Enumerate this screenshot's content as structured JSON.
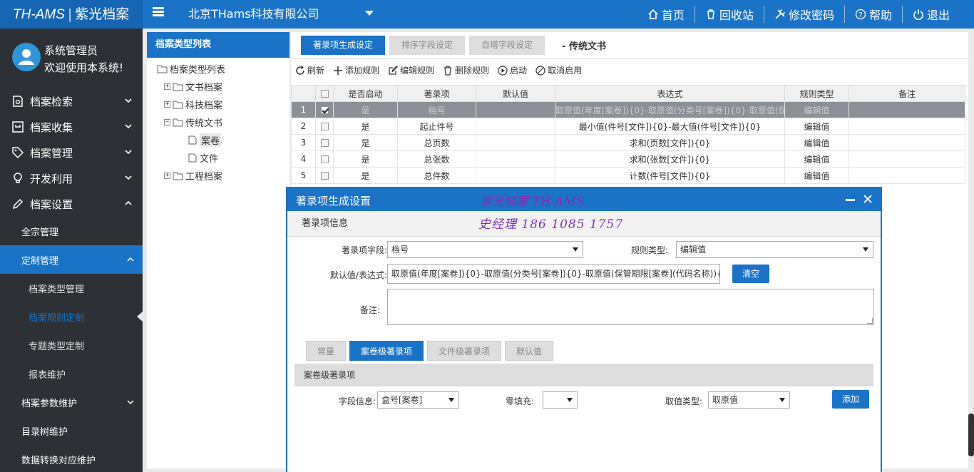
{
  "app": {
    "brand": "TH-AMS",
    "brand_cn": "紫光档案",
    "company": "北京THams科技有限公司"
  },
  "topnav": {
    "home": "首页",
    "recycle": "回收站",
    "password": "修改密码",
    "help": "帮助",
    "logout": "退出"
  },
  "user": {
    "name": "系统管理员",
    "welcome": "欢迎使用本系统!"
  },
  "sidebar": {
    "items": [
      {
        "label": "档案检索",
        "icon": "search-doc-icon"
      },
      {
        "label": "档案收集",
        "icon": "inbox-icon"
      },
      {
        "label": "档案管理",
        "icon": "tag-icon"
      },
      {
        "label": "开发利用",
        "icon": "lightbulb-icon"
      },
      {
        "label": "档案设置",
        "icon": "pencil-icon"
      }
    ],
    "settings_sub": {
      "quanzong": "全宗管理",
      "custom": "定制管理",
      "custom_children": [
        "档案类型管理",
        "档案规则定制",
        "专题类型定制",
        "报表维护"
      ],
      "params": "档案参数维护",
      "catalog_tree": "目录树维护",
      "data_convert": "数据转换对应维护"
    }
  },
  "tree": {
    "header": "档案类型列表",
    "root": "档案类型列表",
    "nodes": [
      "文书档案",
      "科技档案",
      "传统文书",
      "案卷",
      "文件",
      "工程档案"
    ]
  },
  "main": {
    "tabs": [
      "著录项生成设定",
      "排序字段设定",
      "自增字段设定"
    ],
    "title": "- 传统文书",
    "toolbar": {
      "refresh": "刷新",
      "add": "添加规则",
      "edit": "编辑规则",
      "delete": "删除规则",
      "start": "启动",
      "cancel": "取消启用"
    },
    "columns": [
      "是否启动",
      "著录项",
      "默认值",
      "表达式",
      "规则类型",
      "备注"
    ],
    "rows": [
      {
        "no": "1",
        "checked": true,
        "enabled": "是",
        "item": "档号",
        "default": "",
        "expr": "取原值(年度[案卷]){0}-取原值(分类号[案卷]){0}-取原值(保管期限",
        "type": "编辑值",
        "note": ""
      },
      {
        "no": "2",
        "checked": false,
        "enabled": "是",
        "item": "起止件号",
        "default": "",
        "expr": "最小值(件号[文件]){0}-最大值(件号[文件]){0}",
        "type": "编辑值",
        "note": ""
      },
      {
        "no": "3",
        "checked": false,
        "enabled": "是",
        "item": "总页数",
        "default": "",
        "expr": "求和(页数[文件]){0}",
        "type": "编辑值",
        "note": ""
      },
      {
        "no": "4",
        "checked": false,
        "enabled": "是",
        "item": "总张数",
        "default": "",
        "expr": "求和(张数[文件]){0}",
        "type": "编辑值",
        "note": ""
      },
      {
        "no": "5",
        "checked": false,
        "enabled": "是",
        "item": "总件数",
        "default": "",
        "expr": "计数(件号[文件]){0}",
        "type": "编辑值",
        "note": ""
      }
    ]
  },
  "dialog": {
    "title": "著录项生成设置",
    "watermark_line1": "紫光档案 TH-AMS",
    "watermark_line2": "史经理 186 1085 1757",
    "section": "著录项信息",
    "field_label": "著录项字段:",
    "field_value": "档号",
    "rule_type_label": "规则类型:",
    "rule_type_value": "编辑值",
    "expr_label": "默认值/表达式:",
    "expr_value": "取原值(年度[案卷]){0}-取原值(分类号[案卷]){0}-取原值(保管期限[案卷](代码名称)){0}-取",
    "clear_btn": "清空",
    "note_label": "备注:",
    "subtabs": [
      "常量",
      "案卷级著录项",
      "文件级著录项",
      "默认值"
    ],
    "sub_section": "案卷级著录项",
    "field_info_label": "字段信息:",
    "field_info_value": "盒号[案卷]",
    "zero_fill_label": "零填充:",
    "zero_fill_value": "",
    "value_type_label": "取值类型:",
    "value_type_value": "取原值",
    "add_btn": "添加"
  },
  "colors": {
    "accent": "#1a73c7",
    "sidebar": "#2d3135",
    "watermark": "#7f2fb3"
  }
}
